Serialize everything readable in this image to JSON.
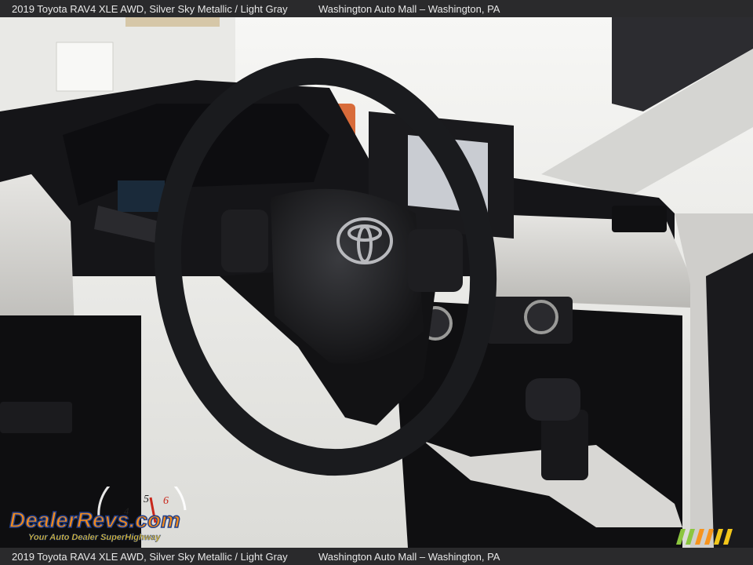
{
  "caption": {
    "vehicle": "2019 Toyota RAV4 XLE AWD,  Silver Sky Metallic / Light Gray",
    "dealer": "Washington Auto Mall – Washington, PA"
  },
  "photo": {
    "subject": "interior-dashboard-steering-wheel",
    "colors": {
      "dash_top": "#151518",
      "dash_trim": "#d8d7d4",
      "wheel": "#1a1b1e",
      "windshield": "#f2f2f0",
      "screen": "#c9ccd2"
    }
  },
  "watermark": {
    "brand": "DealerRevs.com",
    "tagline": "Your Auto Dealer SuperHighway",
    "speedo_digits": [
      "4",
      "5",
      "6"
    ],
    "colors": {
      "orange": "#f08a1c",
      "blue": "#1e3d8a",
      "yellow": "#f2c61a"
    }
  }
}
